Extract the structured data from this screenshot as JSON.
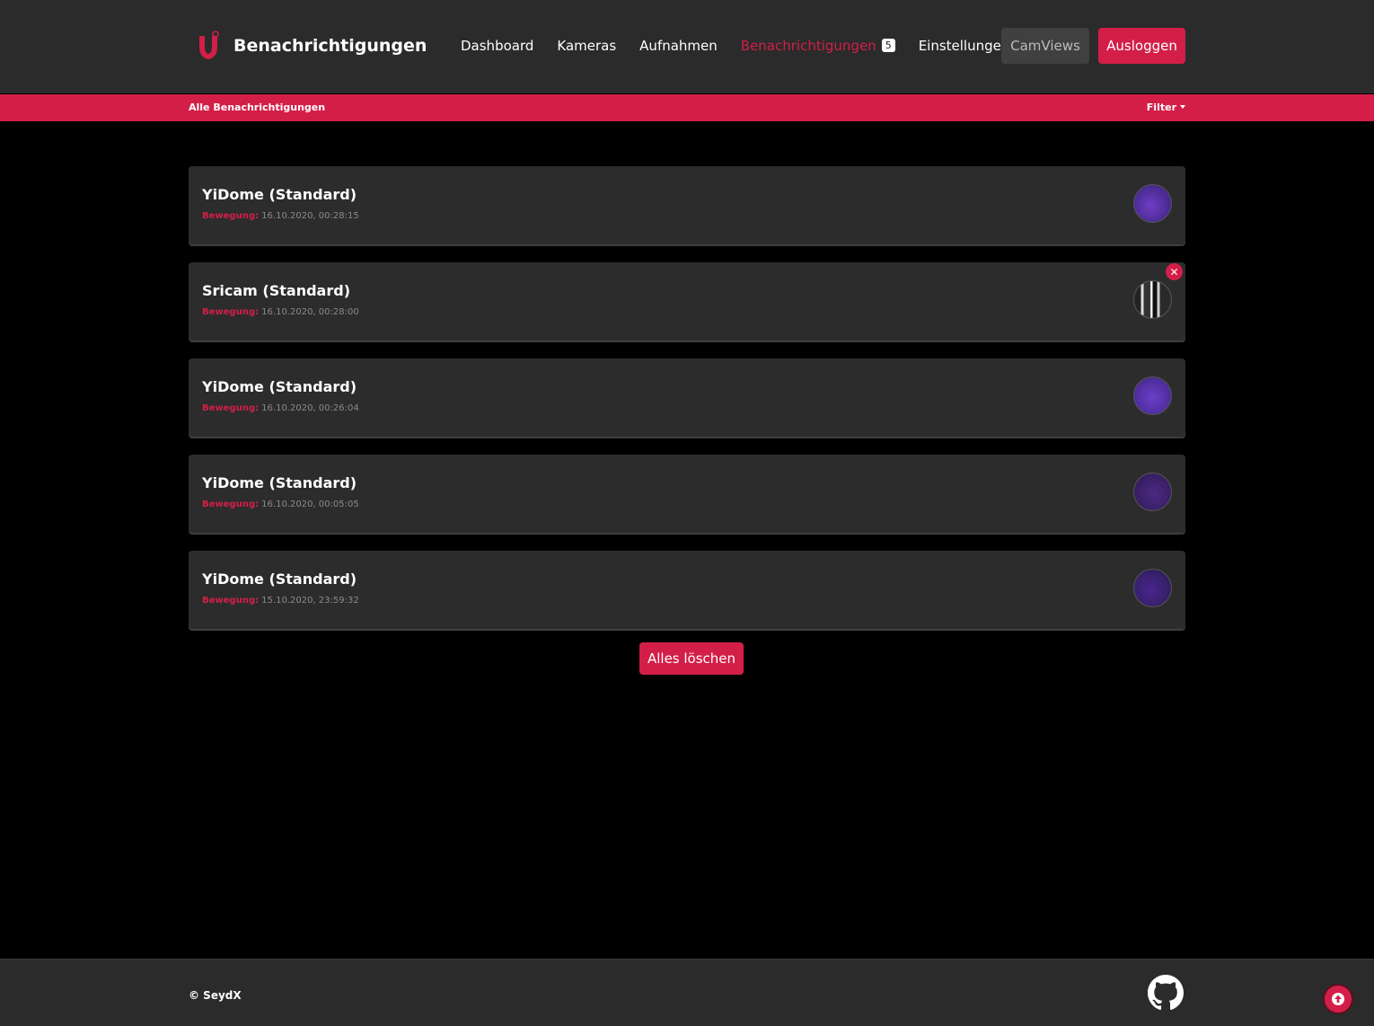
{
  "header": {
    "title": "Benachrichtigungen",
    "nav": [
      {
        "label": "Dashboard",
        "active": false
      },
      {
        "label": "Kameras",
        "active": false
      },
      {
        "label": "Aufnahmen",
        "active": false
      },
      {
        "label": "Benachrichtigungen",
        "active": true,
        "badge": "5"
      },
      {
        "label": "Einstellungen",
        "active": false
      }
    ],
    "camviews_label": "CamViews",
    "logout_label": "Ausloggen"
  },
  "subbar": {
    "title": "Alle Benachrichtigungen",
    "filter_label": "Filter"
  },
  "notifications": [
    {
      "title": "YiDome (Standard)",
      "event": "Bewegung:",
      "time": "16.10.2020, 00:28:15"
    },
    {
      "title": "Sricam (Standard)",
      "event": "Bewegung:",
      "time": "16.10.2020, 00:28:00"
    },
    {
      "title": "YiDome (Standard)",
      "event": "Bewegung:",
      "time": "16.10.2020, 00:26:04"
    },
    {
      "title": "YiDome (Standard)",
      "event": "Bewegung:",
      "time": "16.10.2020, 00:05:05"
    },
    {
      "title": "YiDome (Standard)",
      "event": "Bewegung:",
      "time": "15.10.2020, 23:59:32"
    }
  ],
  "clear_all_label": "Alles löschen",
  "footer": {
    "copyright": "© SeydX"
  },
  "icons": {
    "brand": "camera-ui-logo-icon",
    "close": "close-icon",
    "github": "github-icon",
    "scroll_top": "arrow-up-icon"
  },
  "colors": {
    "accent": "#d31f48",
    "navbar": "#2b2b2b",
    "card": "#2c2c2c",
    "background": "#000000"
  }
}
